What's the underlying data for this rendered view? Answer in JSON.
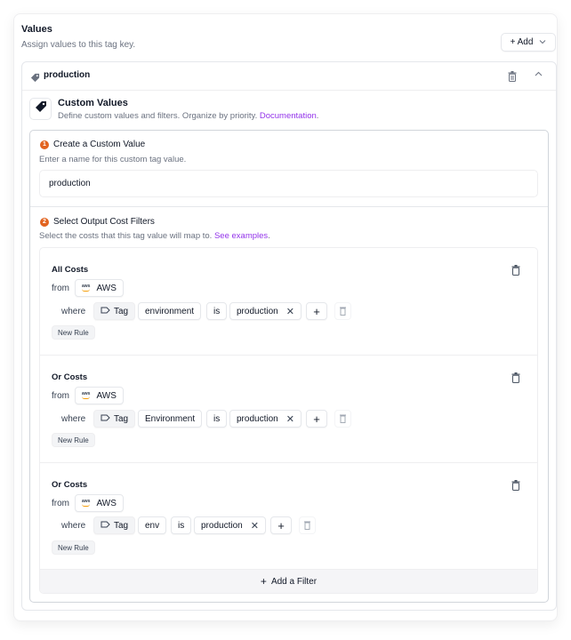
{
  "values_section": {
    "title": "Values",
    "subtitle": "Assign values to this tag key.",
    "add_button": {
      "label": "+ Add",
      "icon": "chevron-down-icon"
    }
  },
  "tag_value": {
    "name": "production",
    "icons": {
      "tag": "tag-icon",
      "delete": "trash-icon",
      "collapse": "chevron-up-icon"
    }
  },
  "custom_values": {
    "title": "Custom Values",
    "subtitle": "Define custom values and filters. Organize by priority.",
    "link": "Documentation",
    "link_suffix": ".",
    "accent_color": "#9333ea"
  },
  "step1": {
    "number": "1",
    "title": "Create a Custom Value",
    "subtitle": "Enter a name for this custom tag value.",
    "input_value": "production",
    "badge_color": "#e2631f"
  },
  "step2": {
    "number": "2",
    "title": "Select Output Cost Filters",
    "subtitle": "Select the costs that this tag value will map to.",
    "link": "See examples",
    "link_suffix": "."
  },
  "filters": [
    {
      "title": "All Costs",
      "from_label": "from",
      "provider": "AWS",
      "provider_logo_text": "aws",
      "where_label": "where",
      "type": "Tag",
      "key": "environment",
      "operator": "is",
      "value": "production",
      "new_rule_label": "New Rule"
    },
    {
      "title": "Or Costs",
      "from_label": "from",
      "provider": "AWS",
      "provider_logo_text": "aws",
      "where_label": "where",
      "type": "Tag",
      "key": "Environment",
      "operator": "is",
      "value": "production",
      "new_rule_label": "New Rule"
    },
    {
      "title": "Or Costs",
      "from_label": "from",
      "provider": "AWS",
      "provider_logo_text": "aws",
      "where_label": "where",
      "type": "Tag",
      "key": "env",
      "operator": "is",
      "value": "production",
      "new_rule_label": "New Rule"
    }
  ],
  "add_filter_label": "Add a Filter"
}
